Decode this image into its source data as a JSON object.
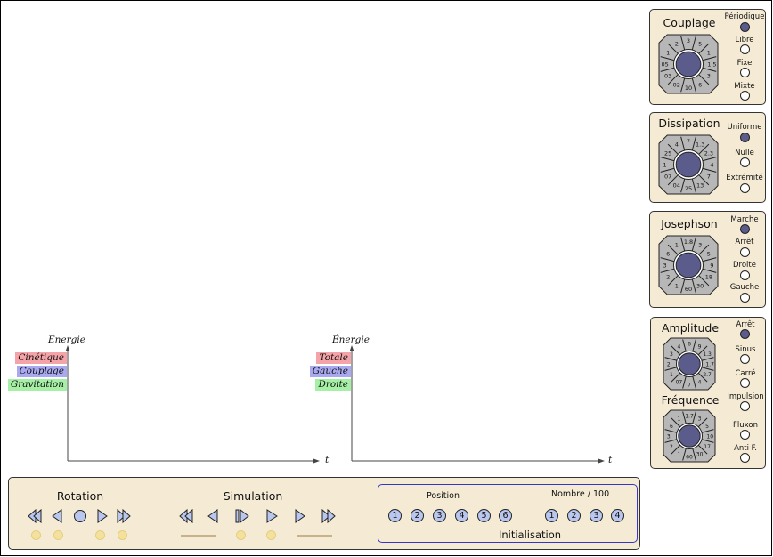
{
  "panels": {
    "couplage": {
      "title": "Couplage",
      "options": [
        "Périodique",
        "Libre",
        "Fixe",
        "Mixte"
      ],
      "dial_values": [
        "5",
        "1",
        "1.5",
        "3",
        "6",
        "10",
        "02",
        "03",
        "05",
        "1",
        "2",
        "3"
      ]
    },
    "dissipation": {
      "title": "Dissipation",
      "options": [
        "Uniforme",
        "Nulle",
        "Extrémité"
      ],
      "dial_values": [
        "1.3",
        "2.3",
        "4",
        "7",
        "13",
        "25",
        "04",
        "07",
        "1",
        "25",
        "4",
        "7"
      ]
    },
    "josephson": {
      "title": "Josephson",
      "options": [
        "Marche",
        "Arrêt",
        "Droite",
        "Gauche"
      ],
      "dial_values": [
        "3",
        "5",
        "9",
        "18",
        "30",
        "60",
        "1",
        "2",
        "3",
        "6",
        "1",
        "1.8"
      ]
    },
    "amplitude": {
      "title": "Amplitude",
      "dial_values": [
        "9",
        "1.3",
        "1.7",
        "2.7",
        "4",
        "7",
        "07",
        "1",
        "2",
        "3",
        "4",
        "6"
      ]
    },
    "frequence": {
      "title": "Fréquence",
      "dial_values": [
        "3",
        "5",
        "10",
        "17",
        "30",
        "60",
        "1",
        "2",
        "3",
        "6",
        "1",
        "1.7"
      ]
    },
    "excitation_options": [
      "Arrêt",
      "Sinus",
      "Carré",
      "Impulsion",
      "Fluxon",
      "Anti F."
    ]
  },
  "plots": {
    "left": {
      "ylabel": "Énergie",
      "xlabel": "t",
      "legend": [
        "Cinétique",
        "Couplage",
        "Gravitation"
      ]
    },
    "right": {
      "ylabel": "Énergie",
      "xlabel": "t",
      "legend": [
        "Totale",
        "Gauche",
        "Droite"
      ]
    }
  },
  "bottom": {
    "rotation_title": "Rotation",
    "simulation_title": "Simulation",
    "position_label": "Position",
    "nombre_label": "Nombre / 100",
    "init_label": "Initialisation",
    "position_buttons": [
      "1",
      "2",
      "3",
      "4",
      "5",
      "6"
    ],
    "nombre_buttons": [
      "1",
      "2",
      "3",
      "4"
    ]
  },
  "colors": {
    "panel_bg": "#f5ebd5",
    "knob": "#5b5b8c",
    "legend_red": "#f4a3a8",
    "legend_blue": "#a9a9f2",
    "legend_green": "#a5f0a5",
    "led": "#f5e19e",
    "init_border": "#3535c8"
  }
}
